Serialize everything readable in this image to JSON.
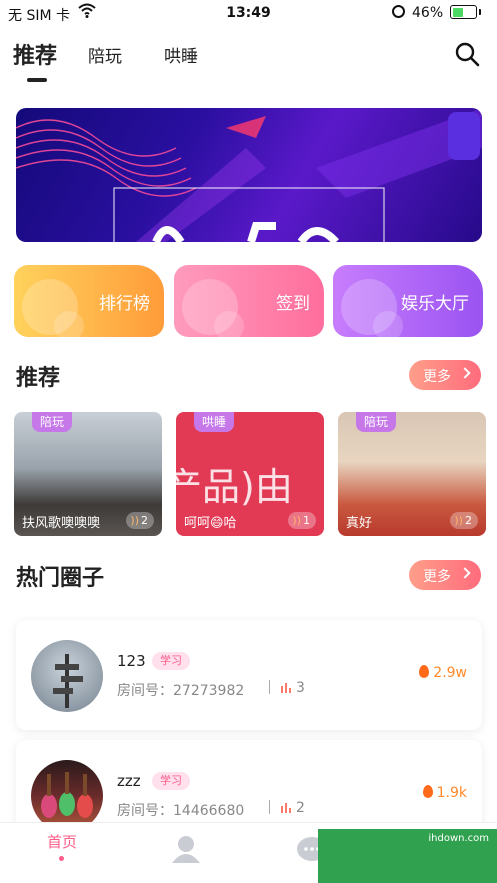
{
  "status_bar": {
    "carrier": "无 SIM 卡",
    "time": "13:49",
    "battery_percent": "46%",
    "battery_level": 0.46
  },
  "top_tabs": [
    {
      "label": "推荐",
      "active": true
    },
    {
      "label": "陪玩",
      "active": false
    },
    {
      "label": "哄睡",
      "active": false
    }
  ],
  "icons": {
    "search": "search-icon",
    "wifi": "wifi-icon",
    "lock": "orientation-lock-icon",
    "battery": "battery-icon"
  },
  "quick_entries": [
    {
      "label": "排行榜",
      "color": "#ff9c3a"
    },
    {
      "label": "签到",
      "color": "#ff6e9d"
    },
    {
      "label": "娱乐大厅",
      "color": "#9b53f2"
    }
  ],
  "recommend": {
    "title": "推荐",
    "more_label": "更多",
    "rooms": [
      {
        "tag": "陪玩",
        "name": "扶风歌噢噢噢",
        "count": "2"
      },
      {
        "tag": "哄睡",
        "name": "呵呵😄哈",
        "count": "1",
        "bg_text": "产品)由"
      },
      {
        "tag": "陪玩",
        "name": "真好",
        "count": "2"
      }
    ]
  },
  "hot_circles": {
    "title": "热门圈子",
    "more_label": "更多",
    "items": [
      {
        "name": "123",
        "tag": "学习",
        "room_label": "房间号：",
        "room_no": "27273982",
        "members": "3",
        "heat": "2.9w"
      },
      {
        "name": "zzz",
        "tag": "学习",
        "room_label": "房间号：",
        "room_no": "14466680",
        "members": "2",
        "heat": "1.9k"
      }
    ]
  },
  "bottom_nav": {
    "home_label": "首页"
  },
  "watermark": "ihdown.com",
  "colors": {
    "accent": "#ff5c8a",
    "more_gradient_start": "#ff9e8a",
    "heat": "#ff8a2a"
  }
}
